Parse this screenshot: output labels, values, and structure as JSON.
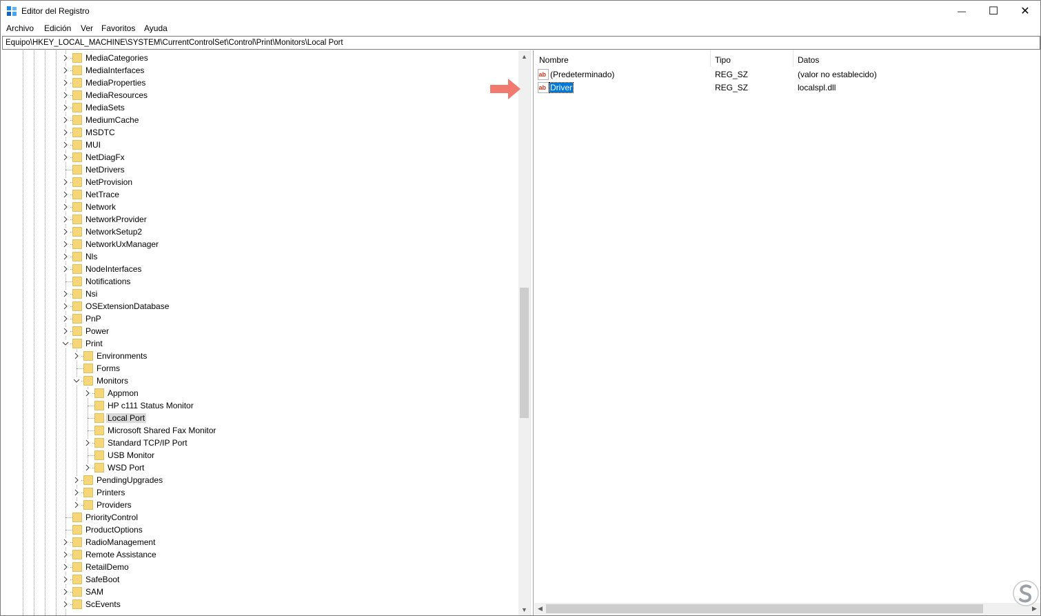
{
  "window": {
    "title": "Editor del Registro",
    "controls": {
      "minimize": "—",
      "maximize": "☐",
      "close": "✕"
    }
  },
  "menu": [
    "Archivo",
    "Edición",
    "Ver",
    "Favoritos",
    "Ayuda"
  ],
  "address": "Equipo\\HKEY_LOCAL_MACHINE\\SYSTEM\\CurrentControlSet\\Control\\Print\\Monitors\\Local Port",
  "tree": [
    {
      "label": "MediaCategories",
      "level": 0,
      "exp": "closed"
    },
    {
      "label": "MediaInterfaces",
      "level": 0,
      "exp": "closed"
    },
    {
      "label": "MediaProperties",
      "level": 0,
      "exp": "closed"
    },
    {
      "label": "MediaResources",
      "level": 0,
      "exp": "closed"
    },
    {
      "label": "MediaSets",
      "level": 0,
      "exp": "closed"
    },
    {
      "label": "MediumCache",
      "level": 0,
      "exp": "closed"
    },
    {
      "label": "MSDTC",
      "level": 0,
      "exp": "closed"
    },
    {
      "label": "MUI",
      "level": 0,
      "exp": "closed"
    },
    {
      "label": "NetDiagFx",
      "level": 0,
      "exp": "closed"
    },
    {
      "label": "NetDrivers",
      "level": 0,
      "exp": "none"
    },
    {
      "label": "NetProvision",
      "level": 0,
      "exp": "closed"
    },
    {
      "label": "NetTrace",
      "level": 0,
      "exp": "closed"
    },
    {
      "label": "Network",
      "level": 0,
      "exp": "closed"
    },
    {
      "label": "NetworkProvider",
      "level": 0,
      "exp": "closed"
    },
    {
      "label": "NetworkSetup2",
      "level": 0,
      "exp": "closed"
    },
    {
      "label": "NetworkUxManager",
      "level": 0,
      "exp": "closed"
    },
    {
      "label": "Nls",
      "level": 0,
      "exp": "closed"
    },
    {
      "label": "NodeInterfaces",
      "level": 0,
      "exp": "closed"
    },
    {
      "label": "Notifications",
      "level": 0,
      "exp": "none"
    },
    {
      "label": "Nsi",
      "level": 0,
      "exp": "closed"
    },
    {
      "label": "OSExtensionDatabase",
      "level": 0,
      "exp": "closed"
    },
    {
      "label": "PnP",
      "level": 0,
      "exp": "closed"
    },
    {
      "label": "Power",
      "level": 0,
      "exp": "closed"
    },
    {
      "label": "Print",
      "level": 0,
      "exp": "open"
    },
    {
      "label": "Environments",
      "level": 1,
      "exp": "closed"
    },
    {
      "label": "Forms",
      "level": 1,
      "exp": "none"
    },
    {
      "label": "Monitors",
      "level": 1,
      "exp": "open"
    },
    {
      "label": "Appmon",
      "level": 2,
      "exp": "closed"
    },
    {
      "label": "HP c111 Status Monitor",
      "level": 2,
      "exp": "none"
    },
    {
      "label": "Local Port",
      "level": 2,
      "exp": "none",
      "selected": true
    },
    {
      "label": "Microsoft Shared Fax Monitor",
      "level": 2,
      "exp": "none"
    },
    {
      "label": "Standard TCP/IP Port",
      "level": 2,
      "exp": "closed"
    },
    {
      "label": "USB Monitor",
      "level": 2,
      "exp": "none"
    },
    {
      "label": "WSD Port",
      "level": 2,
      "exp": "closed"
    },
    {
      "label": "PendingUpgrades",
      "level": 1,
      "exp": "closed"
    },
    {
      "label": "Printers",
      "level": 1,
      "exp": "closed"
    },
    {
      "label": "Providers",
      "level": 1,
      "exp": "closed"
    },
    {
      "label": "PriorityControl",
      "level": 0,
      "exp": "none"
    },
    {
      "label": "ProductOptions",
      "level": 0,
      "exp": "none"
    },
    {
      "label": "RadioManagement",
      "level": 0,
      "exp": "closed"
    },
    {
      "label": "Remote Assistance",
      "level": 0,
      "exp": "closed"
    },
    {
      "label": "RetailDemo",
      "level": 0,
      "exp": "closed"
    },
    {
      "label": "SafeBoot",
      "level": 0,
      "exp": "closed"
    },
    {
      "label": "SAM",
      "level": 0,
      "exp": "closed"
    },
    {
      "label": "ScEvents",
      "level": 0,
      "exp": "closed"
    }
  ],
  "tree_scroll": {
    "position": 0.51,
    "visible": 0.24
  },
  "columns": {
    "name": "Nombre",
    "type": "Tipo",
    "data": "Datos"
  },
  "values": [
    {
      "name": "(Predeterminado)",
      "type": "REG_SZ",
      "data": "(valor no establecido)",
      "icon": "string-value-icon",
      "selected": false
    },
    {
      "name": "Driver",
      "type": "REG_SZ",
      "data": "localspl.dll",
      "icon": "string-value-icon",
      "selected": true
    }
  ],
  "colors": {
    "selection": "#0078d7",
    "tree_selection": "#d9d9d9",
    "folder": "#f5d77a",
    "folder_edge": "#d8b548",
    "arrow": "#f07a70"
  }
}
